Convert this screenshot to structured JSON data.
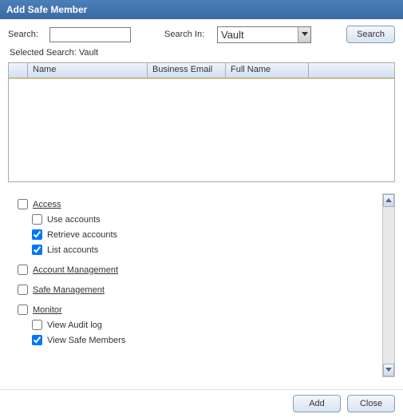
{
  "title": "Add Safe Member",
  "search": {
    "label": "Search:",
    "value": "",
    "in_label": "Search In:",
    "in_value": "Vault",
    "button": "Search"
  },
  "selected_search": "Selected Search: Vault",
  "grid": {
    "columns": [
      "Name",
      "Business Email",
      "Full Name"
    ]
  },
  "permissions": {
    "sections": [
      {
        "label": "Access",
        "checked": false,
        "items": [
          {
            "label": "Use accounts",
            "checked": false
          },
          {
            "label": "Retrieve accounts",
            "checked": true
          },
          {
            "label": "List accounts",
            "checked": true
          }
        ]
      },
      {
        "label": "Account Management",
        "checked": false,
        "items": []
      },
      {
        "label": "Safe Management",
        "checked": false,
        "items": []
      },
      {
        "label": "Monitor",
        "checked": false,
        "items": [
          {
            "label": "View Audit log",
            "checked": false
          },
          {
            "label": "View Safe Members",
            "checked": true
          }
        ]
      }
    ]
  },
  "footer": {
    "add": "Add",
    "close": "Close"
  }
}
